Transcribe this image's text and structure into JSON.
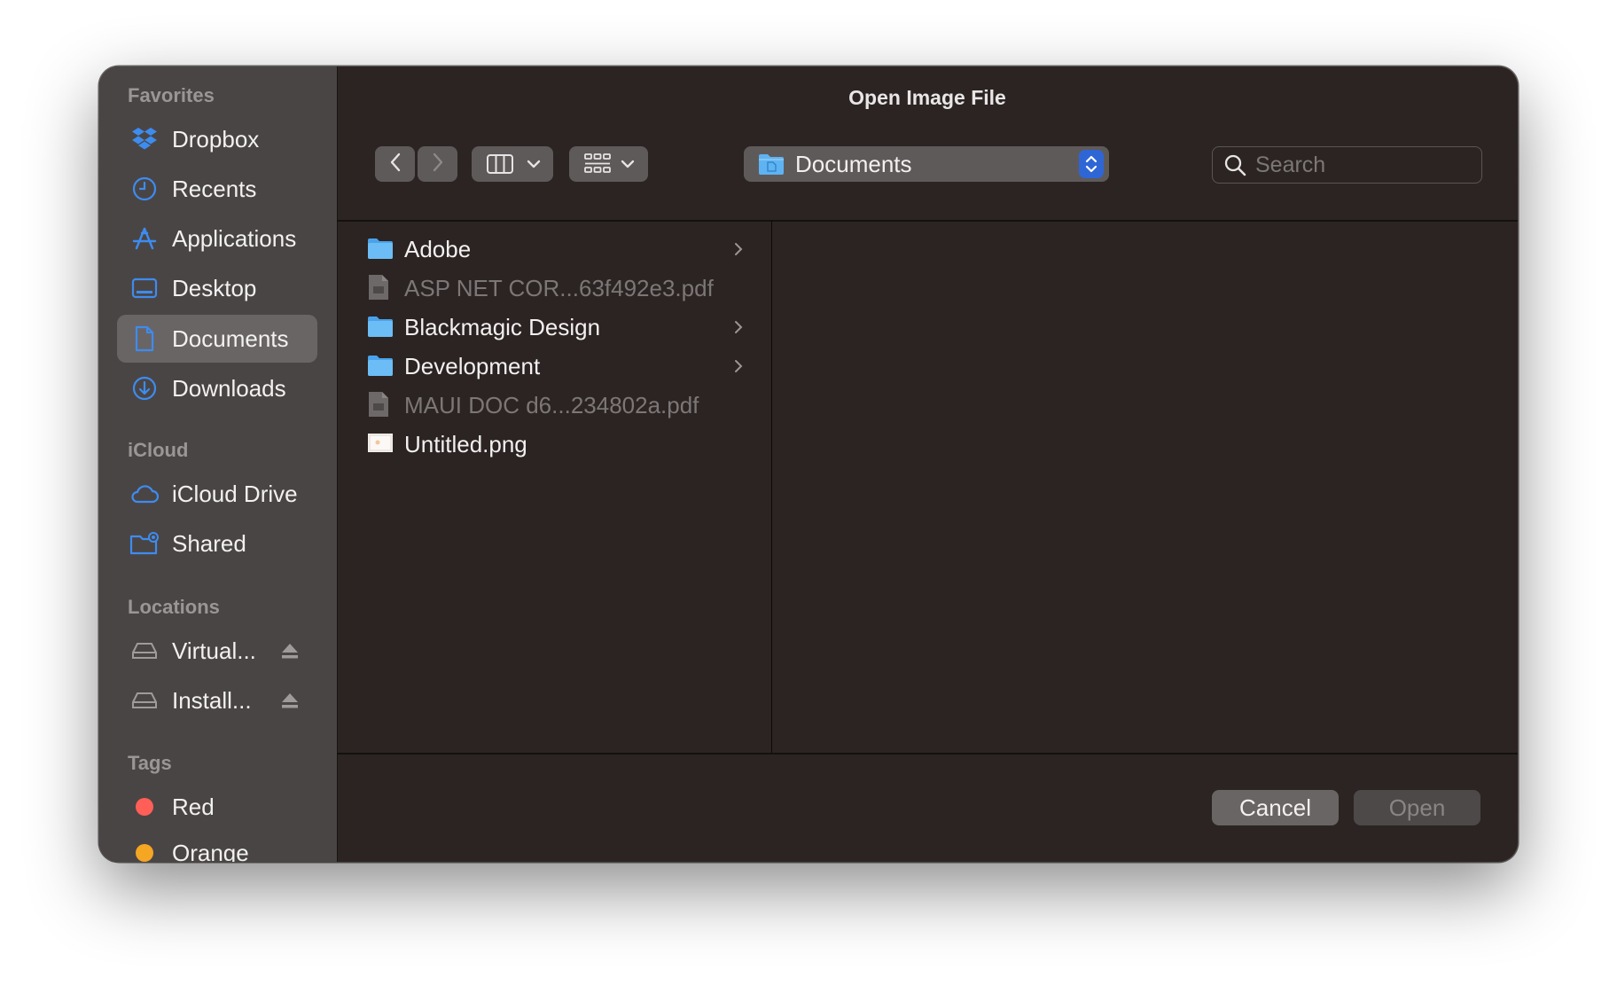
{
  "dialog": {
    "title": "Open Image File"
  },
  "sidebar": {
    "sections": [
      {
        "label": "Favorites"
      },
      {
        "label": "iCloud"
      },
      {
        "label": "Locations"
      },
      {
        "label": "Tags"
      }
    ],
    "favorites": [
      {
        "label": "Dropbox",
        "icon": "dropbox-icon"
      },
      {
        "label": "Recents",
        "icon": "clock-icon"
      },
      {
        "label": "Applications",
        "icon": "applications-icon"
      },
      {
        "label": "Desktop",
        "icon": "desktop-icon"
      },
      {
        "label": "Documents",
        "icon": "document-icon",
        "selected": true
      },
      {
        "label": "Downloads",
        "icon": "download-icon"
      }
    ],
    "icloud": [
      {
        "label": "iCloud Drive",
        "icon": "cloud-icon"
      },
      {
        "label": "Shared",
        "icon": "shared-folder-icon"
      }
    ],
    "locations": [
      {
        "label": "Virtual...",
        "icon": "drive-icon",
        "ejectable": true
      },
      {
        "label": "Install...",
        "icon": "drive-icon",
        "ejectable": true
      }
    ],
    "tags": [
      {
        "label": "Red",
        "color": "#ff5f57"
      },
      {
        "label": "Orange",
        "color": "#f5a623"
      }
    ]
  },
  "toolbar": {
    "location": "Documents",
    "search_placeholder": "Search"
  },
  "files": [
    {
      "name": "Adobe",
      "type": "folder",
      "enabled": true,
      "has_children": true
    },
    {
      "name": "ASP NET COR...63f492e3.pdf",
      "type": "pdf",
      "enabled": false,
      "has_children": false
    },
    {
      "name": "Blackmagic Design",
      "type": "folder",
      "enabled": true,
      "has_children": true
    },
    {
      "name": "Development",
      "type": "folder",
      "enabled": true,
      "has_children": true
    },
    {
      "name": "MAUI DOC d6...234802a.pdf",
      "type": "pdf",
      "enabled": false,
      "has_children": false
    },
    {
      "name": "Untitled.png",
      "type": "image",
      "enabled": true,
      "has_children": false
    }
  ],
  "buttons": {
    "cancel": "Cancel",
    "open": "Open"
  },
  "colors": {
    "accent": "#2f66d6",
    "sidebar_icon": "#3d8cf0",
    "folder": "#5eb3f2"
  }
}
